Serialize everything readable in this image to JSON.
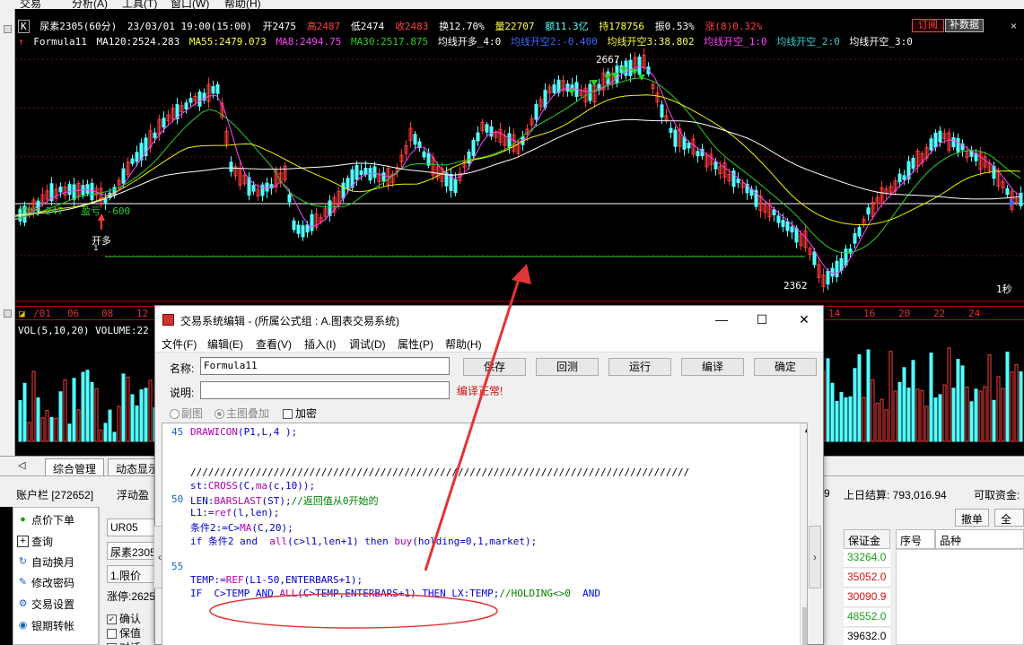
{
  "menubar": {
    "items": [
      "交易",
      "分析(A)",
      "工具(T)",
      "窗口(W)",
      "帮助(H)"
    ]
  },
  "quote": {
    "k_icon": "K",
    "symbol": "尿素2305(60分)",
    "datetime": "23/03/01 19:00(15:00)",
    "open": "开2475",
    "high": "高2487",
    "low": "低2474",
    "close": "收2483",
    "turnover": "换12.70%",
    "volume": "量22707",
    "amount": "额11.3亿",
    "holding": "持178756",
    "amplitude": "振0.53%",
    "change": "涨(8)0.32%",
    "red_button": "订阅",
    "gray_button": "补数据"
  },
  "formula_line": {
    "name": "Formula11",
    "ma120": "MA120:2524.283",
    "ma55": "MA55:2479.073",
    "ma8": "MA8:2494.75",
    "ma30": "MA30:2517.875",
    "duo4": "均线开多_4:0",
    "kong2": "均线开空2:-0.400",
    "kong3": "均线开空3:38.802",
    "kong_1": "均线开空_1:0",
    "kong_2": "均线开空_2:0",
    "kong_3": "均线开空_3:0"
  },
  "chart_labels": {
    "peak": "2667",
    "trough": "2362",
    "avg_line": "均价 247",
    "profit": "盈亏 -600",
    "open_long": "开多",
    "open_long_n": "1",
    "period": "1秒"
  },
  "date_axis": [
    "/01",
    "06",
    "08",
    "12",
    "14",
    "16",
    "20",
    "22",
    "24"
  ],
  "volume_info": "VOL(5,10,20) VOLUME:22",
  "colors": {
    "up": "#ff3b3b",
    "down": "#54ffff",
    "ma_yellow": "#f0f000",
    "ma_magenta": "#ff40ff",
    "ma_green": "#2bd02b",
    "ma_white": "#ffffff",
    "arrow": "#e03535"
  },
  "tabs": [
    "综合管理",
    "动态显示"
  ],
  "account": {
    "label": "账户栏 [272652]",
    "floating": "浮动盈",
    "digit": "9",
    "settle": "上日结算: 793,016.94",
    "available": "可取资金:"
  },
  "sidebar": [
    {
      "icon": "cursor-icon",
      "label": "点价下单"
    },
    {
      "icon": "plus-square-icon",
      "label": "查询"
    },
    {
      "icon": "refresh-icon",
      "label": "自动换月"
    },
    {
      "icon": "edit-icon",
      "label": "修改密码"
    },
    {
      "icon": "gear-icon",
      "label": "交易设置"
    },
    {
      "icon": "bank-icon",
      "label": "银期转帐"
    }
  ],
  "order_panel": {
    "contract": "UR05",
    "name": "尿素2305",
    "price_type": "1.限价",
    "limit_up": "涨停:2625",
    "confirm": "确认",
    "keep": "保值",
    "third": "对话"
  },
  "right_panel": {
    "undo": "撤单",
    "all": "全部",
    "margin_header": "保证金",
    "seq_header": "序号",
    "product_header": "品种",
    "margins": [
      {
        "value": "33264.0",
        "color": "#1a9e1a"
      },
      {
        "value": "35052.0",
        "color": "#d01010"
      },
      {
        "value": "30090.9",
        "color": "#d01010"
      },
      {
        "value": "48552.0",
        "color": "#1a9e1a"
      },
      {
        "value": "39632.0",
        "color": "#000000"
      }
    ]
  },
  "dialog": {
    "title": "交易系统编辑 - (所属公式组 : A.图表交易系统)",
    "menu": [
      "文件(F)",
      "编辑(E)",
      "查看(V)",
      "插入(I)",
      "调试(D)",
      "属性(P)",
      "帮助(H)"
    ],
    "name_label": "名称:",
    "name_value": "Formula11",
    "desc_label": "说明:",
    "desc_value": "",
    "buttons": [
      "保存",
      "回测",
      "运行",
      "编译",
      "确定"
    ],
    "compile_status": "编译正常!",
    "radio_sub": "副图",
    "radio_main": "主图叠加",
    "encrypt": "加密",
    "line_numbers": [
      "45",
      "50",
      "55"
    ],
    "code": [
      "DRAWICON(P1,L,4 );",
      "",
      "",
      "////////////////////////////////////////////////////////////////////////////////////",
      "st:CROSS(C,ma(c,10));",
      "LEN:BARSLAST(ST);//返回值从0开始的",
      "L1:=ref(l,len);",
      "条件2:=C>MA(C,20);",
      "if 条件2 and  all(c>l1,len+1) then buy(holding=0,1,market);",
      "",
      "",
      "TEMP:=REF(L1-50,ENTERBARS+1);",
      "IF  C>TEMP AND ALL(C>TEMP,ENTERBARS+1) THEN LX:TEMP;//HOLDING<>0  AND"
    ]
  }
}
